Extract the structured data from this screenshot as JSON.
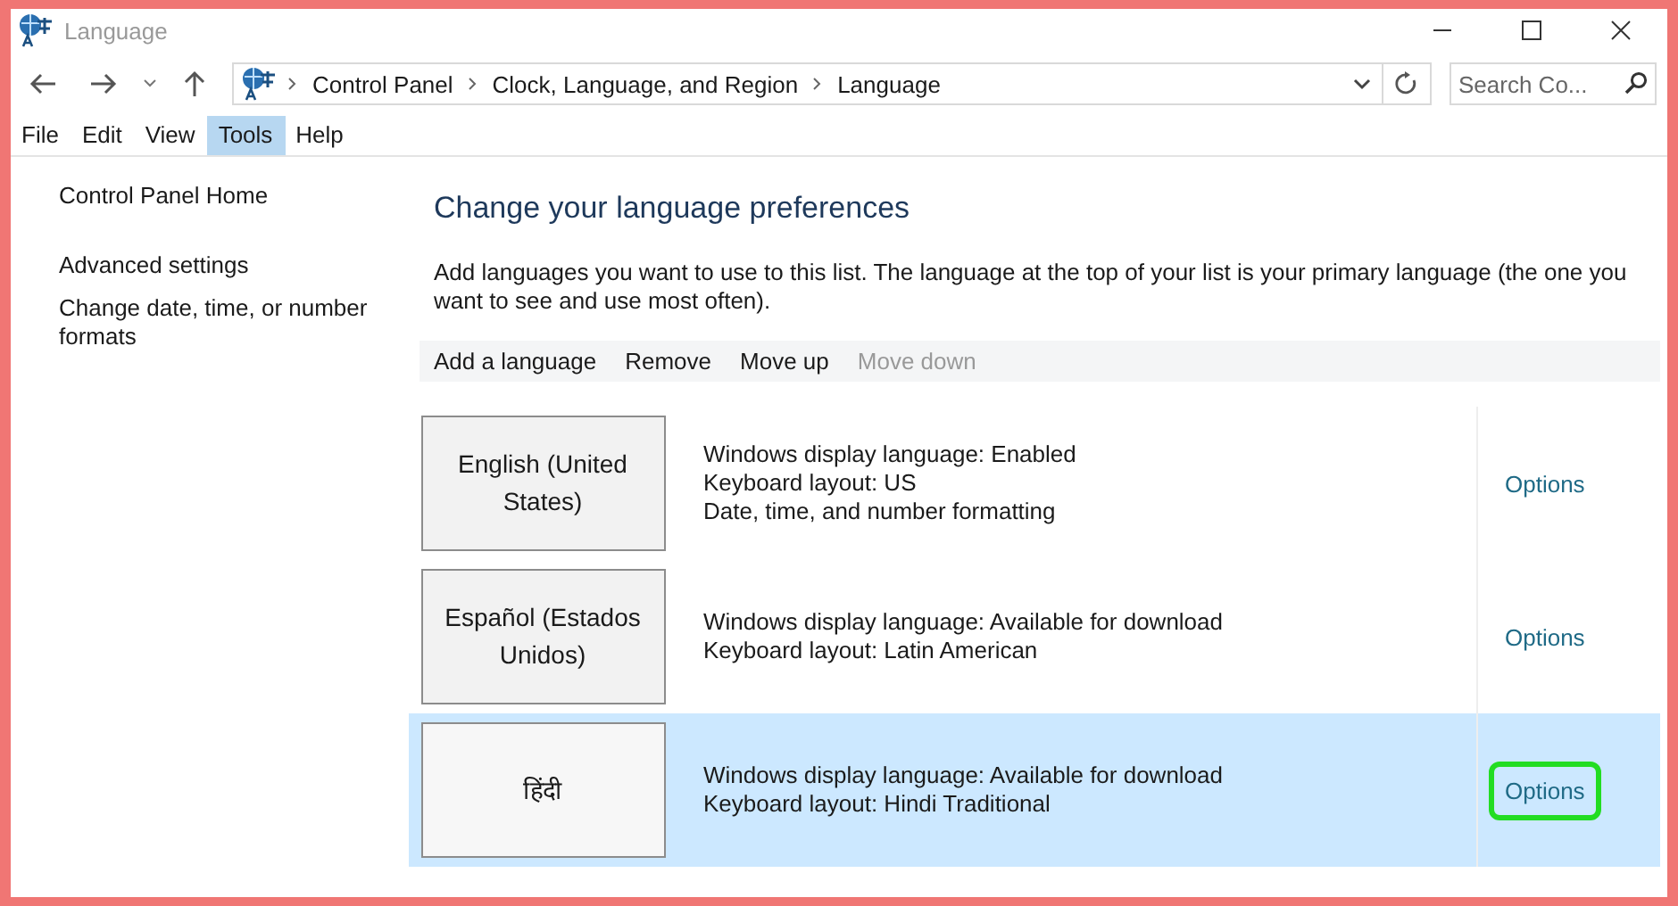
{
  "window": {
    "title": "Language"
  },
  "address_bar": {
    "breadcrumbs": [
      "Control Panel",
      "Clock, Language, and Region",
      "Language"
    ]
  },
  "search": {
    "placeholder": "Search Co..."
  },
  "menu": [
    {
      "label": "File",
      "selected": false
    },
    {
      "label": "Edit",
      "selected": false
    },
    {
      "label": "View",
      "selected": false
    },
    {
      "label": "Tools",
      "selected": true
    },
    {
      "label": "Help",
      "selected": false
    }
  ],
  "sidebar": {
    "items": [
      "Control Panel Home",
      "Advanced settings",
      "Change date, time, or number formats"
    ]
  },
  "heading": "Change your language preferences",
  "description": "Add languages you want to use to this list. The language at the top of your list is your primary language (the one you want to see and use most often).",
  "toolbar": [
    {
      "label": "Add a language",
      "disabled": false
    },
    {
      "label": "Remove",
      "disabled": false
    },
    {
      "label": "Move up",
      "disabled": false
    },
    {
      "label": "Move down",
      "disabled": true
    }
  ],
  "languages": [
    {
      "name": "English (United States)",
      "details": [
        "Windows display language: Enabled",
        "Keyboard layout: US",
        "Date, time, and number formatting"
      ],
      "options": "Options",
      "selected": false,
      "highlighted": false
    },
    {
      "name": "Español (Estados Unidos)",
      "details": [
        "Windows display language: Available for download",
        "Keyboard layout: Latin American"
      ],
      "options": "Options",
      "selected": false,
      "highlighted": false
    },
    {
      "name": "हिंदी",
      "details": [
        "Windows display language: Available for download",
        "Keyboard layout: Hindi Traditional"
      ],
      "options": "Options",
      "selected": true,
      "highlighted": true
    }
  ]
}
